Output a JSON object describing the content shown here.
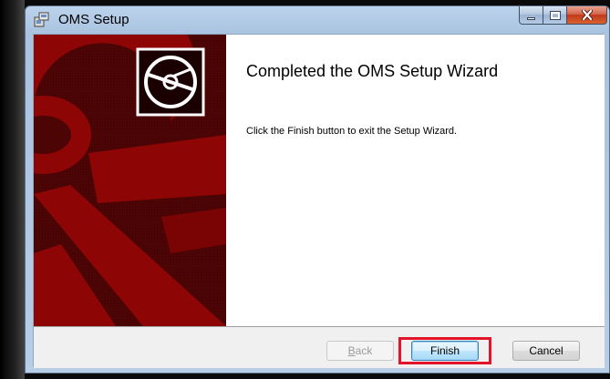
{
  "window": {
    "title": "OMS Setup"
  },
  "wizard": {
    "heading": "Completed the OMS Setup Wizard",
    "description": "Click the Finish button to exit the Setup Wizard."
  },
  "buttons": {
    "back_prefix": "",
    "back_mnemonic": "B",
    "back_rest": "ack",
    "finish": "Finish",
    "cancel": "Cancel"
  },
  "icons": {
    "window_icon": "installer-icon",
    "logo": "disc-icon"
  },
  "colors": {
    "banner": "#4c0404",
    "banner_accent": "#8e0505",
    "highlight": "#e3142a"
  },
  "state": {
    "back_enabled": false,
    "finish_default": true
  }
}
